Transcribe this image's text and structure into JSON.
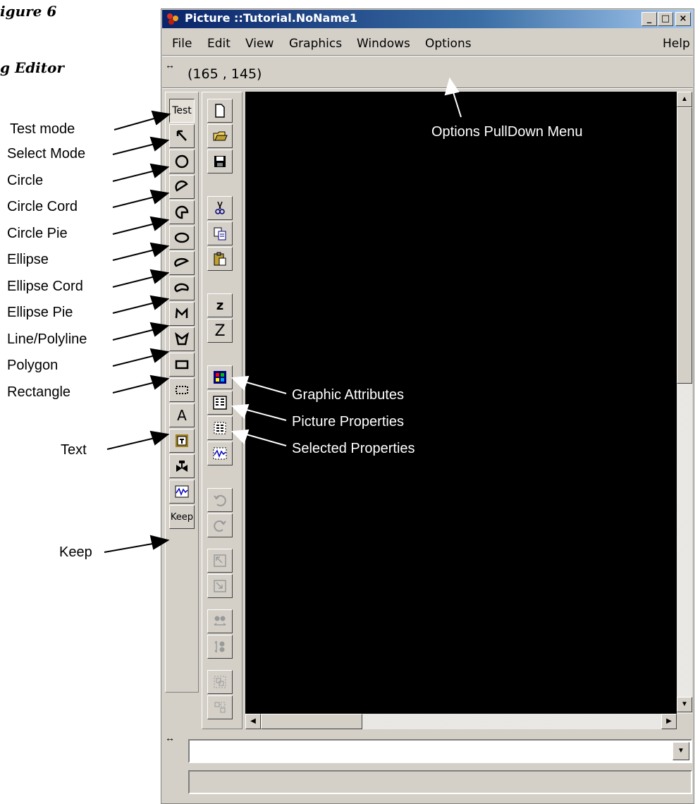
{
  "figure": {
    "title": "igure 6",
    "subtitle": "g Editor"
  },
  "window": {
    "title": "Picture ::Tutorial.NoName1",
    "minimize_label": "_",
    "maximize_label": "□",
    "close_label": "×",
    "title_icon": "app-icon"
  },
  "menu": {
    "items": [
      "File",
      "Edit",
      "View",
      "Graphics",
      "Windows",
      "Options"
    ],
    "help": "Help"
  },
  "status": {
    "coords": "(165 , 145)",
    "resize_glyph": "↔"
  },
  "left_toolbar": {
    "tools": [
      {
        "name": "test-mode",
        "label": "Test",
        "pressed": true
      },
      {
        "name": "select-mode",
        "icon": "arrow-icon"
      },
      {
        "name": "circle",
        "icon": "circle-icon"
      },
      {
        "name": "circle-cord",
        "icon": "circle-cord-icon"
      },
      {
        "name": "circle-pie",
        "icon": "circle-pie-icon"
      },
      {
        "name": "ellipse",
        "icon": "ellipse-icon"
      },
      {
        "name": "ellipse-cord",
        "icon": "ellipse-cord-icon"
      },
      {
        "name": "ellipse-pie",
        "icon": "ellipse-pie-icon"
      },
      {
        "name": "line-polyline",
        "icon": "polyline-icon"
      },
      {
        "name": "polygon",
        "icon": "polygon-icon"
      },
      {
        "name": "rectangle",
        "icon": "rectangle-icon"
      },
      {
        "name": "dotted-rect",
        "icon": "dotted-rectangle-icon"
      },
      {
        "name": "text",
        "label": "A"
      },
      {
        "name": "image",
        "icon": "image-frame-icon"
      },
      {
        "name": "valve",
        "icon": "valve-icon"
      },
      {
        "name": "trend",
        "icon": "trend-icon"
      },
      {
        "name": "keep",
        "label": "Keep"
      }
    ]
  },
  "right_toolbar": {
    "tools": [
      {
        "name": "new",
        "icon": "new-file-icon"
      },
      {
        "name": "open",
        "icon": "open-folder-icon"
      },
      {
        "name": "save",
        "icon": "save-disk-icon"
      },
      {
        "name": "cut",
        "icon": "scissors-icon"
      },
      {
        "name": "copy",
        "icon": "copy-icon"
      },
      {
        "name": "paste",
        "icon": "paste-icon"
      },
      {
        "name": "zoom-in",
        "label": "z"
      },
      {
        "name": "zoom-out",
        "label": "Z"
      },
      {
        "name": "graphic-attributes",
        "icon": "color-palette-icon"
      },
      {
        "name": "picture-properties",
        "icon": "picture-properties-icon"
      },
      {
        "name": "selected-properties",
        "icon": "selected-properties-icon"
      },
      {
        "name": "trend-props",
        "icon": "trend-icon"
      },
      {
        "name": "undo",
        "icon": "undo-icon"
      },
      {
        "name": "redo",
        "icon": "redo-icon"
      },
      {
        "name": "to-front",
        "icon": "bring-front-icon"
      },
      {
        "name": "to-back",
        "icon": "send-back-icon"
      },
      {
        "name": "align-h",
        "icon": "align-horizontal-icon"
      },
      {
        "name": "align-v",
        "icon": "align-vertical-icon"
      },
      {
        "name": "group",
        "icon": "group-icon"
      },
      {
        "name": "ungroup",
        "icon": "ungroup-icon"
      }
    ]
  },
  "callouts": {
    "test_mode": "Test mode",
    "select_mode": "Select Mode",
    "circle": "Circle",
    "circle_cord": "Circle Cord",
    "circle_pie": "Circle Pie",
    "ellipse": "Ellipse",
    "ellipse_cord": "Ellipse Cord",
    "ellipse_pie": "Ellipse Pie",
    "line_polyline": "Line/Polyline",
    "polygon": "Polygon",
    "rectangle": "Rectangle",
    "text": "Text",
    "keep": "Keep",
    "options_menu": "Options PullDown Menu",
    "graphic_attributes": "Graphic Attributes",
    "picture_properties": "Picture Properties",
    "selected_properties": "Selected Properties"
  },
  "colors": {
    "title_bar": "#0a246a",
    "window_face": "#d4d0c8",
    "canvas": "#000000"
  }
}
